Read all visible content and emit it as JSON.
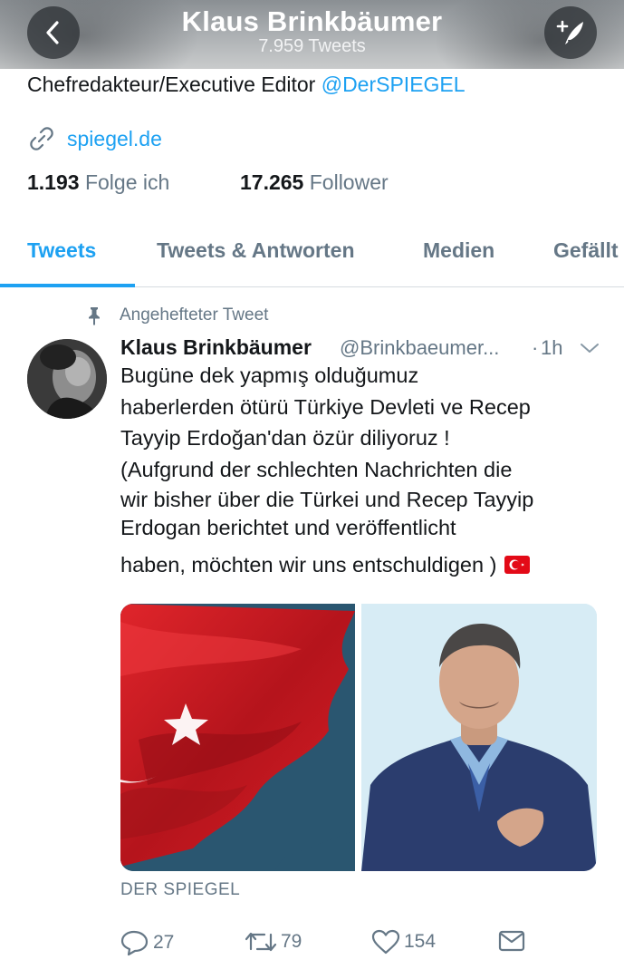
{
  "header": {
    "title": "Klaus Brinkbäumer",
    "subtitle": "7.959 Tweets",
    "back_icon": "chevron-left-icon",
    "compose_icon": "compose-tweet-icon"
  },
  "profile": {
    "bio_text": "Chefredakteur/Executive Editor ",
    "bio_mention": "@DerSPIEGEL",
    "link": "spiegel.de",
    "following_count": "1.193",
    "following_label": "Folge ich",
    "followers_count": "17.265",
    "followers_label": "Follower"
  },
  "tabs": [
    {
      "label": "Tweets",
      "active": true
    },
    {
      "label": "Tweets & Antworten",
      "active": false
    },
    {
      "label": "Medien",
      "active": false
    },
    {
      "label": "Gefällt",
      "active": false
    }
  ],
  "tweet": {
    "pinned_label": "Angehefteter Tweet",
    "author_name": "Klaus Brinkbäumer",
    "author_handle": "@Brinkbaeumer...",
    "separator": "·",
    "time": "1h",
    "lines": [
      "Bugüne dek yapmış olduğumuz",
      "haberlerden ötürü Türkiye Devleti ve Recep",
      "Tayyip Erdoğan'dan özür diliyoruz !",
      "(Aufgrund der schlechten Nachrichten die",
      "wir bisher über die Türkei und Recep Tayyip",
      "Erdogan berichtet und veröffentlicht",
      "haben, möchten wir uns entschuldigen )"
    ],
    "flag_emoji_name": "turkey-flag-emoji",
    "media_left": "turkish-flag-photo",
    "media_right": "portrait-photo",
    "source": "DER SPIEGEL",
    "replies": "27",
    "retweets": "79",
    "likes": "154"
  },
  "colors": {
    "accent": "#1da1f2",
    "secondary_text": "#657786",
    "primary_text": "#14171a",
    "flag_red": "#e30a17"
  }
}
